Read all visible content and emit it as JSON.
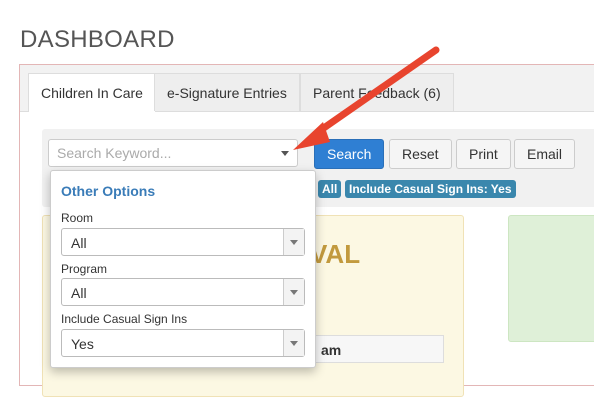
{
  "page": {
    "title": "DASHBOARD"
  },
  "tabs": [
    {
      "label": "Children In Care",
      "active": true
    },
    {
      "label": "e-Signature Entries",
      "active": false
    },
    {
      "label": "Parent Feedback (6)",
      "active": false
    }
  ],
  "search": {
    "placeholder": "Search Keyword..."
  },
  "toolbar": {
    "search_label": "Search",
    "reset_label": "Reset",
    "print_label": "Print",
    "email_label": "Email"
  },
  "filters": {
    "badge_all": "All",
    "badge_casual": "Include Casual Sign Ins: Yes"
  },
  "background": {
    "card_text": "VAL",
    "table_header": "am"
  },
  "other_options": {
    "title": "Other Options",
    "room": {
      "label": "Room",
      "value": "All"
    },
    "program": {
      "label": "Program",
      "value": "All"
    },
    "casual": {
      "label": "Include Casual Sign Ins",
      "value": "Yes"
    }
  },
  "colors": {
    "accent_blue": "#2f7fd3",
    "badge_blue": "#3a87ad",
    "annotation_red": "#e8442e"
  }
}
